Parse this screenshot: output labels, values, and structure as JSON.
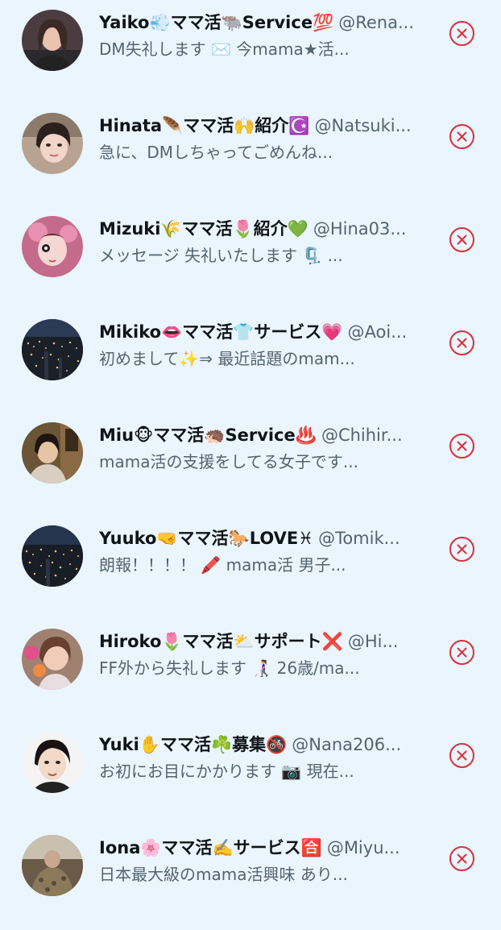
{
  "users": [
    {
      "name": "Yaiko💨ママ活🐃Service💯",
      "handle": "@Rena...",
      "bio": "DM失礼します ✉️ 今mama★活...",
      "avatar": "portrait-icon"
    },
    {
      "name": "Hinata🪶ママ活🙌紹介☪️",
      "handle": "@Natsuki...",
      "bio": "急に、DMしちゃってごめんね...",
      "avatar": "portrait-icon"
    },
    {
      "name": "Mizuki🌾ママ活🌷紹介💚",
      "handle": "@Hina03...",
      "bio": "メッセージ 失礼いたします 🗜️ ...",
      "avatar": "portrait-icon"
    },
    {
      "name": "Mikiko👄ママ活👕サービス💗",
      "handle": "@Aoi...",
      "bio": "初めまして✨⇒ 最近話題のmam...",
      "avatar": "night-city-icon"
    },
    {
      "name": "Miu🐵ママ活🦔Service♨️",
      "handle": "@Chihir...",
      "bio": "mama活の支援をしてる女子です...",
      "avatar": "portrait-icon"
    },
    {
      "name": "Yuuko🤜ママ活🐎LOVE♓",
      "handle": "@Tomik...",
      "bio": "朗報！！！！ 🖍️ mama活 男子...",
      "avatar": "night-city-icon"
    },
    {
      "name": "Hiroko🌷ママ活⛅サポート❌",
      "handle": "@Hi...",
      "bio": "FF外から失礼します 👩‍🦯 26歳/ma...",
      "avatar": "portrait-icon"
    },
    {
      "name": "Yuki✋ママ活☘️募集🚳",
      "handle": "@Nana206...",
      "bio": "お初にお目にかかります 📷 現在...",
      "avatar": "portrait-icon"
    },
    {
      "name": "Iona🌸ママ活✍️サービス🈴",
      "handle": "@Miyu...",
      "bio": "日本最大級のmama活興味 あり...",
      "avatar": "portrait-icon"
    }
  ],
  "colors": {
    "background": "#eaf5fd",
    "name": "#0f1419",
    "secondary": "#536471",
    "remove": "#d9303c"
  },
  "icons": {
    "remove": "close-circle-icon"
  }
}
